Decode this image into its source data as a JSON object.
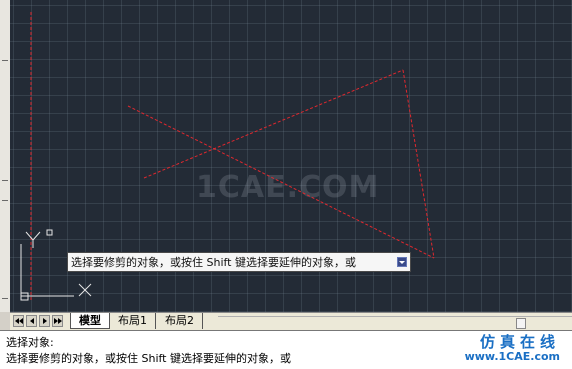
{
  "canvas": {
    "watermark": "1CAE.COM",
    "colors": {
      "background": "#232b36",
      "line": "#e0282e",
      "ucs": "#e6e6e6"
    },
    "ucs_icon": {
      "y_label": "Y",
      "x_label": "X"
    }
  },
  "prompt_tooltip": {
    "text": "选择要修剪的对象，或按住 Shift 键选择要延伸的对象，或",
    "dropdown_icon": "dropdown-arrow-icon"
  },
  "layout_tabs": {
    "tabs": [
      {
        "label": "模型",
        "active": true
      },
      {
        "label": "布局1",
        "active": false
      },
      {
        "label": "布局2",
        "active": false
      }
    ]
  },
  "command_line": {
    "line1": "选择对象:",
    "line2": "选择要修剪的对象，或按住 Shift 键选择要延伸的对象，或"
  },
  "site_logo": {
    "title": "仿真在线",
    "url": "www.1CAE.com"
  }
}
